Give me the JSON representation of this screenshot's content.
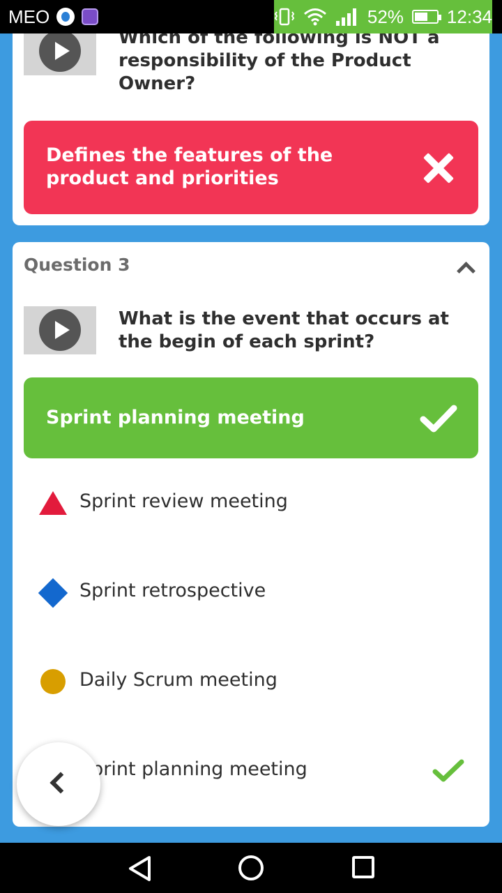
{
  "status_bar": {
    "carrier": "MEO",
    "battery": "52%",
    "time": "12:34",
    "icons": [
      "drop-icon",
      "image-icon",
      "vibrate-icon",
      "wifi-icon",
      "signal-icon",
      "battery-icon"
    ]
  },
  "question2": {
    "text": "Which of the following is NOT a responsibility of the Product Owner?",
    "selected_answer": "Defines the features of the product and priorities",
    "result": "wrong",
    "colors": {
      "wrong": "#f23555"
    }
  },
  "question3": {
    "label": "Question 3",
    "text": "What is the event that occurs at the begin of each sprint?",
    "selected_answer": "Sprint planning meeting",
    "result": "correct",
    "options": [
      {
        "shape": "triangle",
        "color": "#e21b3c",
        "label": "Sprint review meeting"
      },
      {
        "shape": "diamond",
        "color": "#1368ce",
        "label": "Sprint retrospective"
      },
      {
        "shape": "circle",
        "color": "#d89e00",
        "label": "Daily Scrum meeting"
      },
      {
        "shape": "square",
        "color": "#26890c",
        "label": "Sprint planning meeting",
        "correct": true
      }
    ],
    "colors": {
      "correct": "#66bf3c"
    }
  },
  "background_color": "#3d9be0"
}
